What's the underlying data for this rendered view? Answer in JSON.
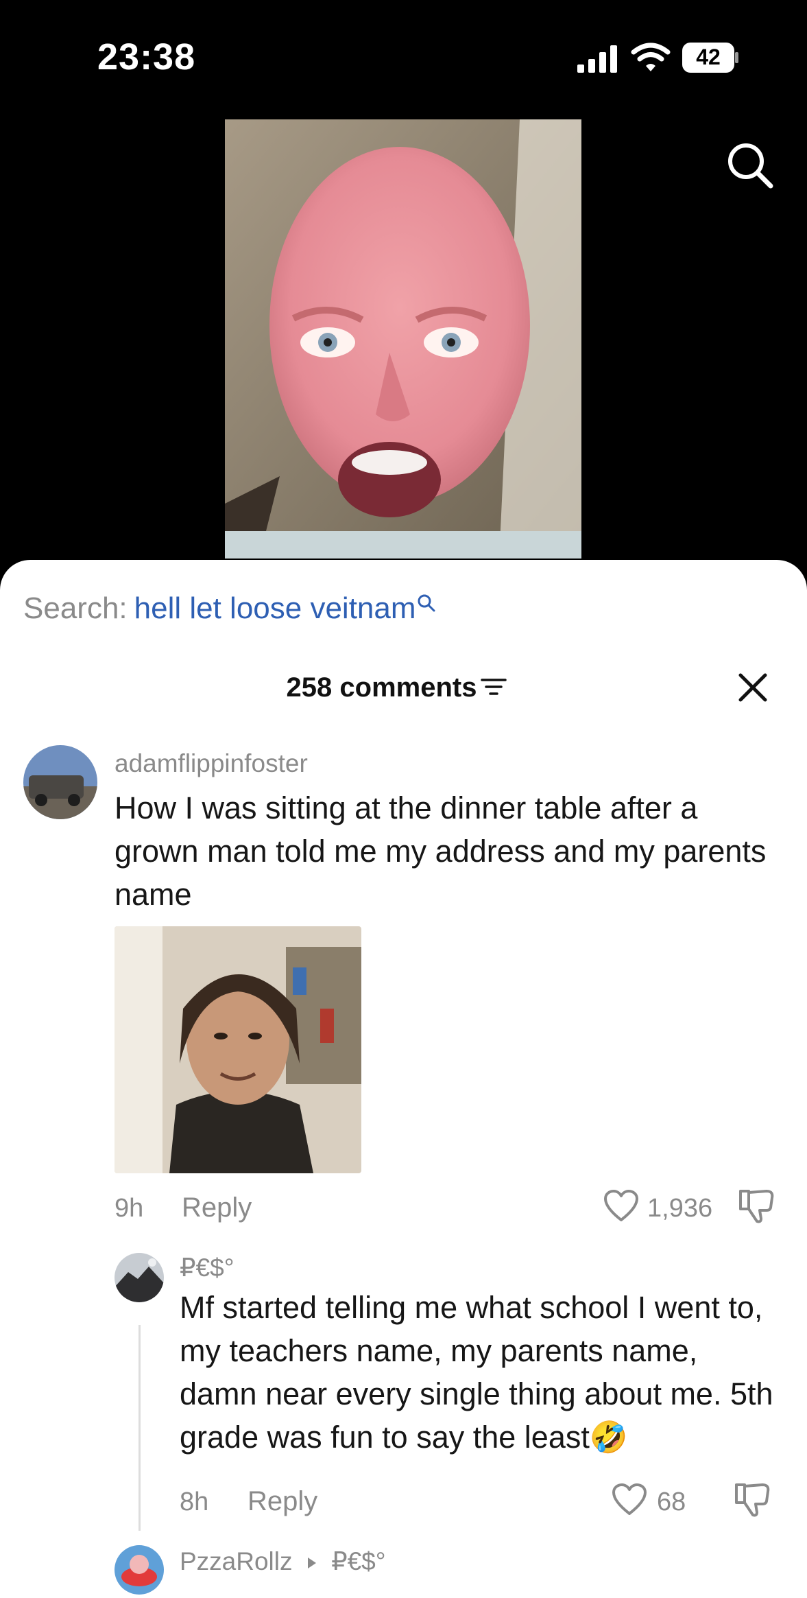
{
  "status_bar": {
    "time": "23:38",
    "battery": "42"
  },
  "search_bar": {
    "label": "Search:",
    "query": "hell let loose veitnam"
  },
  "comments_header": {
    "count_label": "258 comments"
  },
  "comments": [
    {
      "username": "adamflippinfoster",
      "text": "How I was sitting at the dinner table after a grown man told me my address and my parents name",
      "time": "9h",
      "reply_label": "Reply",
      "likes": "1,936"
    },
    {
      "username": "₽€$°",
      "text": "Mf started telling me what school I went to, my teachers name, my parents name, damn near every single thing about me. 5th grade was fun to say the least🤣",
      "time": "8h",
      "reply_label": "Reply",
      "likes": "68"
    },
    {
      "username": "PzzaRollz",
      "reply_to": "₽€$°"
    }
  ],
  "colors": {
    "accent_link": "#2e5fb3",
    "muted_text": "#8a8a8a",
    "sheet_bg": "#ffffff",
    "screen_bg": "#000000"
  },
  "icons": [
    "signal-icon",
    "wifi-icon",
    "battery-icon",
    "search-icon",
    "filter-icon",
    "close-icon",
    "heart-icon",
    "dislike-icon",
    "caret-right-icon"
  ]
}
